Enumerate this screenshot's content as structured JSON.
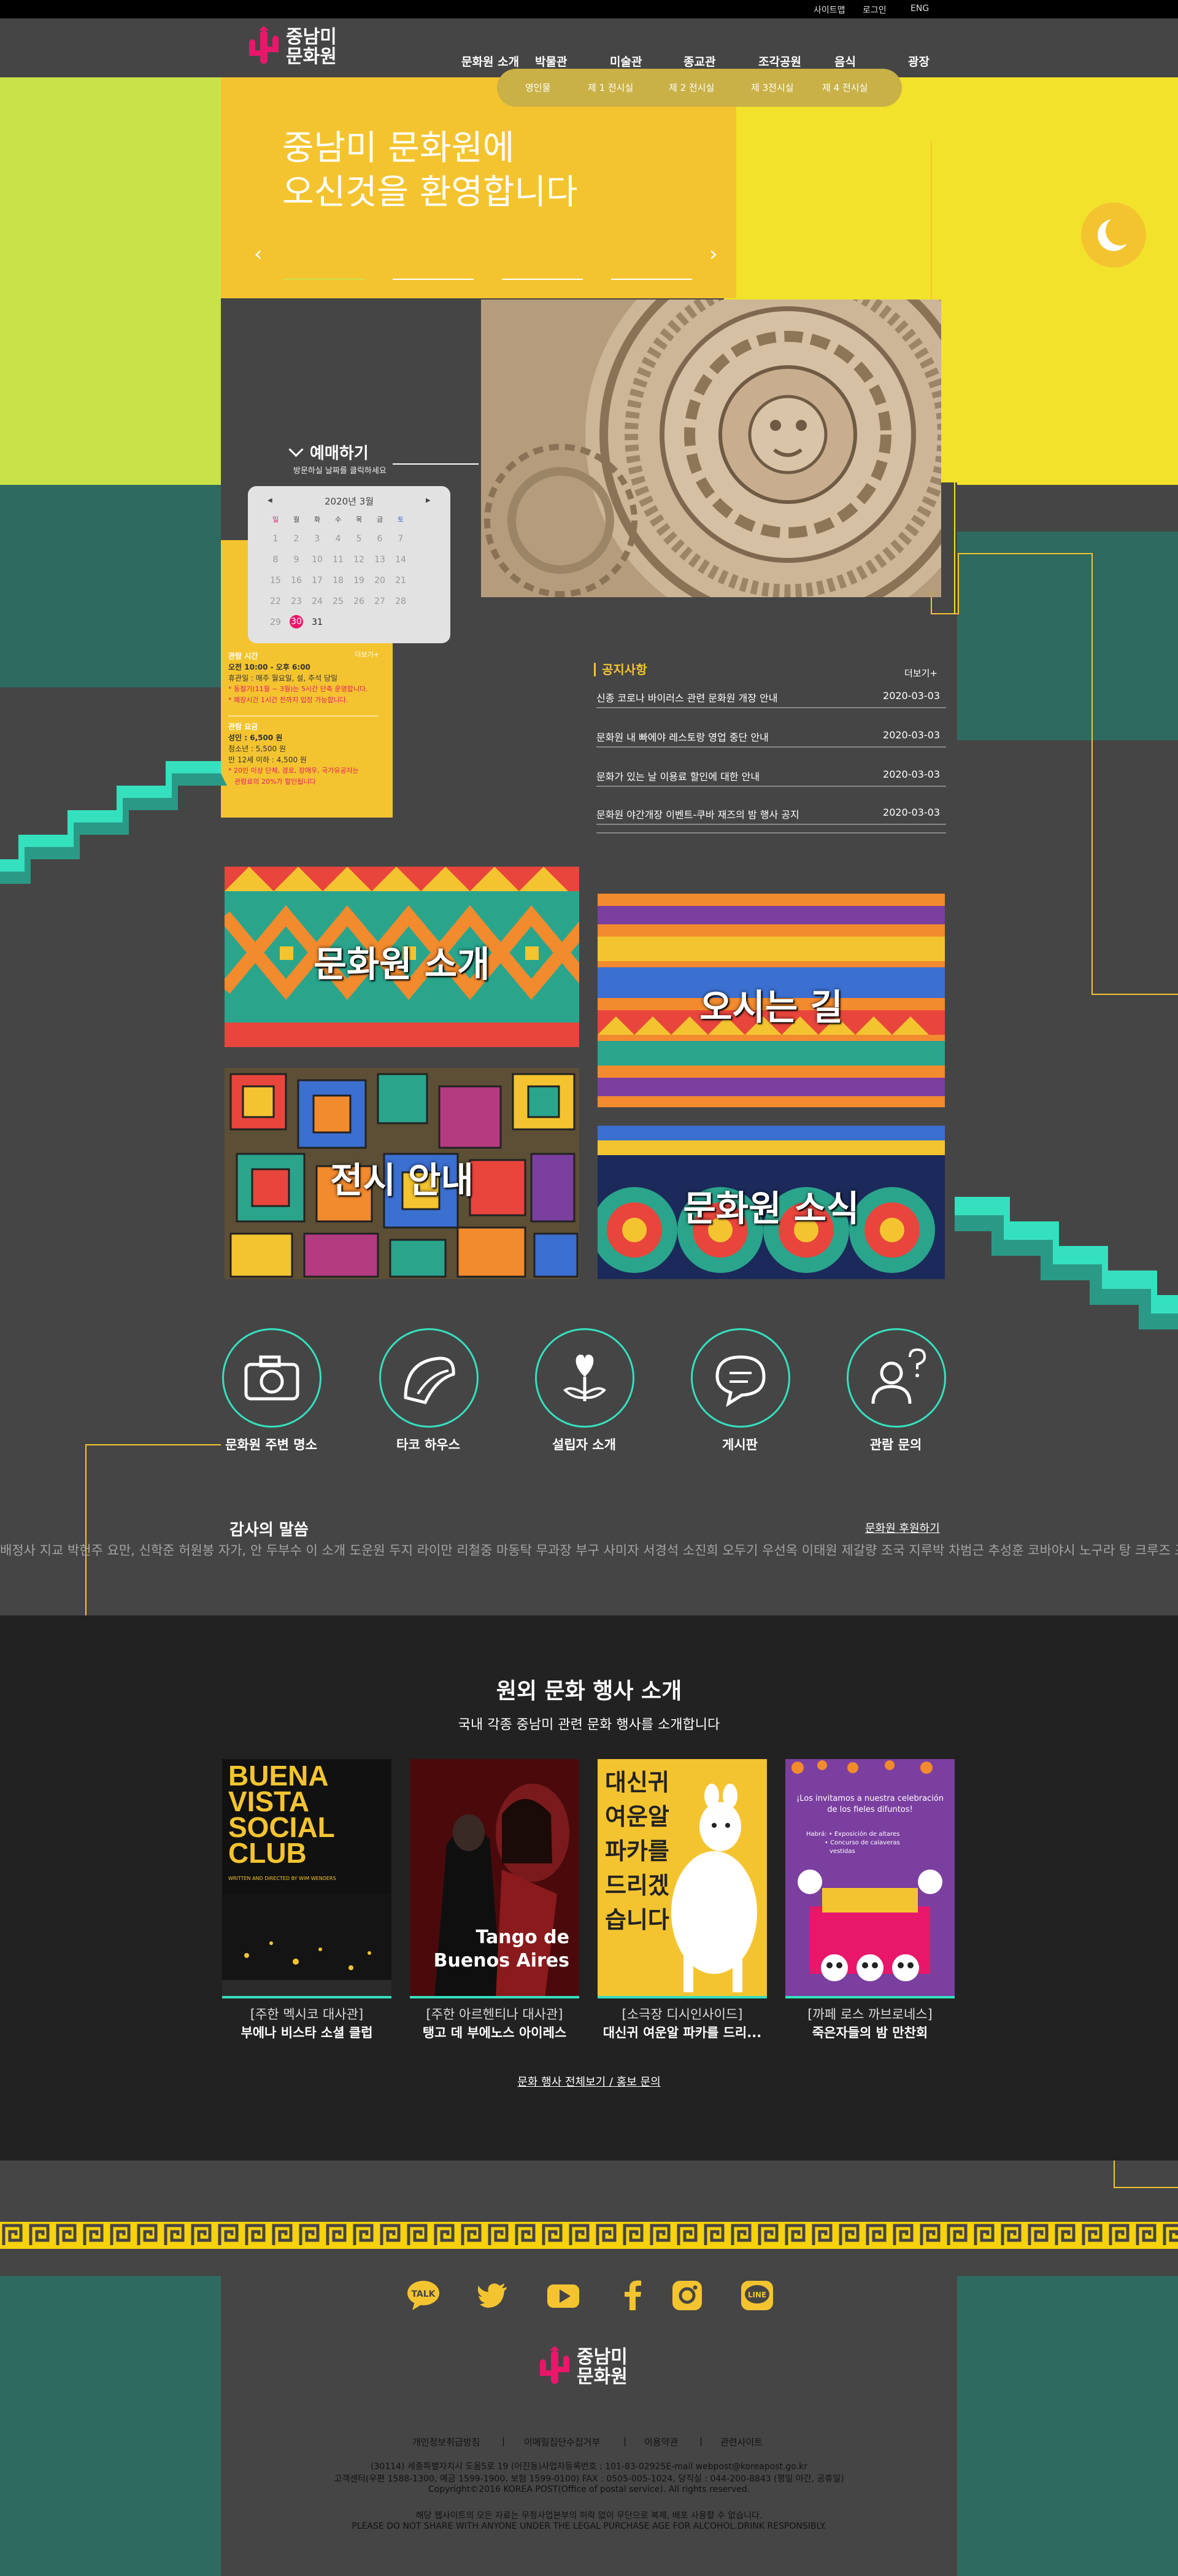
{
  "topbar": {
    "sitemap": "사이트맵",
    "login": "로그인",
    "lang": "ENG"
  },
  "logo": {
    "line1": "중남미",
    "line2": "문화원"
  },
  "nav": [
    "문화원 소개",
    "박물관",
    "미술관",
    "종교관",
    "조각공원",
    "음식",
    "광장"
  ],
  "subnav": [
    "영인물",
    "제 1 전시실",
    "제 2 전시실",
    "제 3전시실",
    "제 4 전시실"
  ],
  "hero": {
    "line1": "중남미 문화원에",
    "line2": "오신것을 환영합니다"
  },
  "booking": {
    "title": "예매하기",
    "hint": "방문하실 날짜를 클릭하세요"
  },
  "calendar": {
    "month": "2020년 3월",
    "prev": "◀",
    "next": "▶",
    "weekdays": [
      "일",
      "월",
      "화",
      "수",
      "목",
      "금",
      "토"
    ],
    "days": [
      "1",
      "2",
      "3",
      "4",
      "5",
      "6",
      "7",
      "8",
      "9",
      "10",
      "11",
      "12",
      "13",
      "14",
      "15",
      "16",
      "17",
      "18",
      "19",
      "20",
      "21",
      "22",
      "23",
      "24",
      "25",
      "26",
      "27",
      "28",
      "29",
      "30",
      "31"
    ],
    "today": "30"
  },
  "hours": {
    "title": "관람 시간",
    "more": "더보기+",
    "line1": "오전 10:00 - 오후 6:00",
    "line2": "휴관일 : 매주 월요일, 설, 추석 당일",
    "line3": "* 동절기(11월 ~ 3월)는 5시간 단축 운영합니다.",
    "line4": "* 폐장시간 1시간 전까지 입장 가능합니다."
  },
  "fees": {
    "title": "관람 요금",
    "adult": "성인 : 6,500 원",
    "teen": "청소년 : 5,500 원",
    "child": "만 12세 이하 : 4,500 원",
    "note1": "* 20인 이상 단체, 경로, 장애우, 국가유공자는",
    "note2": "관람료의 20%가 할인됩니다"
  },
  "notice": {
    "title": "공지사항",
    "more": "더보기+",
    "items": [
      {
        "text": "신종 코로나 바이러스 관련 문화원 개장 안내",
        "date": "2020-03-03"
      },
      {
        "text": "문화원 내 빠에야 레스토랑 영업 중단 안내",
        "date": "2020-03-03"
      },
      {
        "text": "문화가 있는 날 이용료 할인에 대한 안내",
        "date": "2020-03-03"
      },
      {
        "text": "문화원 야간개장 이벤트-쿠바 재즈의 밤 행사 공지",
        "date": "2020-03-03"
      }
    ]
  },
  "tiles": {
    "intro": "문화원 소개",
    "directions": "오시는 길",
    "exhibit": "전시 안내",
    "news": "문화원 소식"
  },
  "quick": [
    "문화원 주변 명소",
    "타코 하우스",
    "설립자 소개",
    "게시판",
    "관람 문의"
  ],
  "thanks": {
    "title": "감사의 말씀",
    "link": "문화원 후원하기",
    "names": "배정사 지교 박헌주 요만, 신학준 허원봉 자가, 안 두부수 이 소개 도운원 두지 라이만 리철중 마동탁 무과장 부구 사미자 서경석 소진희 오두기 우선옥 이태원 제갈량 조국 지루박 차범근 추성훈 코바야시 노구라 탕 크루즈 포미트 하오하오"
  },
  "events": {
    "title": "원외 문화 행사 소개",
    "subtitle": "국내 각종 중남미 관련 문화 행사를 소개합니다",
    "items": [
      {
        "venue": "[주한 멕시코 대사관]",
        "name": "부에나 비스타 소셜 클럽"
      },
      {
        "venue": "[주한 아르헨티나 대사관]",
        "name": "탱고 데 부에노스 아이레스"
      },
      {
        "venue": "[소극장 디시인사이드]",
        "name": "대신귀 여운알 파카를 드리..."
      },
      {
        "venue": "[까페 로스 까브로네스]",
        "name": "죽은자들의 밤 만찬회"
      }
    ],
    "poster1": {
      "l1": "BUENA",
      "l2": "VISTA",
      "l3": "SOCIAL",
      "l4": "CLUB",
      "small": "WRITTEN AND DIRECTED BY WIM WENDERS"
    },
    "poster2": {
      "l1": "Tango de",
      "l2": "Buenos Aires"
    },
    "poster3": {
      "l1": "대신귀",
      "l2": "여운알",
      "l3": "파카를",
      "l4": "드리겠",
      "l5": "습니다"
    },
    "poster4": {
      "l1": "¡Los invitamos a nuestra celebración",
      "l2": "de los fieles difuntos!",
      "b1": "Habrá: • Exposición de altares",
      "b2": "• Concurso de calaveras",
      "b3": "vestidas"
    },
    "all": "문화 행사 전체보기 / 홍보 문의"
  },
  "social": [
    "talk-icon",
    "twitter-icon",
    "youtube-icon",
    "facebook-icon",
    "instagram-icon",
    "line-icon"
  ],
  "footer": {
    "links": [
      "개인정보취급방침",
      "이메일집단수집거부",
      "이용약관",
      "관련사이트"
    ],
    "sep": "|",
    "addr1": "(30114) 세종특별자치시 도움5로 19 (어진동)사업자등록번호 : 101-83-02925E-mail webpost@koreapost.go.kr",
    "addr2": "고객센터(우편 1588-1300, 예금 1599-1900, 보험 1599-0100) FAX : 0505-005-1024, 당직실 : 044-200-8843 (평일 야간, 공휴일)",
    "copy": "Copyright©2016 KOREA POST(Office of postal service). All rights reserved.",
    "warn1": "해당 웹사이트의 모든 자료는 무정사업본부의 허락 없이 무단으로 복제, 배포 사용할 수 없습니다.",
    "warn2": "PLEASE DO NOT SHARE WITH ANYONE UNDER THE LEGAL PURCHASE AGE FOR ALCOHOL.DRINK RESPONSIBLY."
  },
  "colors": {
    "lime": "#c9e24a",
    "yellow": "#f2e22c",
    "gold": "#f4c430",
    "teal": "#35e0bf",
    "darkteal": "#2f6a60",
    "pink": "#e8176a"
  }
}
